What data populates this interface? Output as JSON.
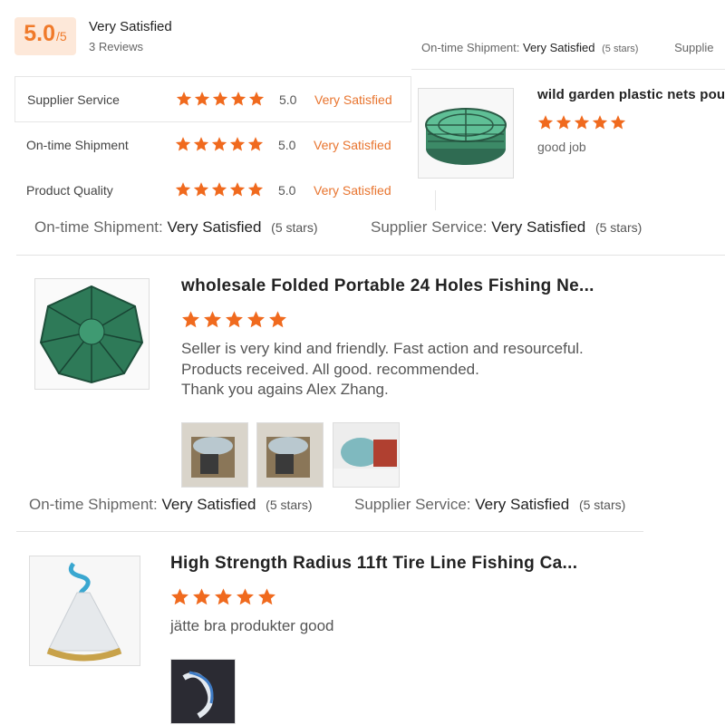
{
  "summary": {
    "score": "5.0",
    "out_of": "/5",
    "title": "Very Satisfied",
    "reviews": "3 Reviews"
  },
  "ratings": [
    {
      "label": "Supplier Service",
      "score": "5.0",
      "text": "Very Satisfied",
      "stars": 5
    },
    {
      "label": "On-time Shipment",
      "score": "5.0",
      "text": "Very Satisfied",
      "stars": 5
    },
    {
      "label": "Product Quality",
      "score": "5.0",
      "text": "Very Satisfied",
      "stars": 5
    }
  ],
  "top_review": {
    "shipment_label": "On-time Shipment:",
    "shipment_value": "Very Satisfied",
    "shipment_stars": "(5 stars)",
    "supplier_cut": "Supplie",
    "product_title": "wild garden plastic nets poult",
    "stars": 5,
    "comment": "good job"
  },
  "meta_1": {
    "shipment_label": "On-time Shipment:",
    "shipment_value": "Very Satisfied",
    "shipment_stars": "(5 stars)",
    "supplier_label": "Supplier Service:",
    "supplier_value": "Very Satisfied",
    "supplier_stars": "(5 stars)"
  },
  "review_2": {
    "product_title": "wholesale Folded Portable 24 Holes Fishing Ne...",
    "stars": 5,
    "comment_line1": "Seller is very kind and friendly. Fast action and resourceful.",
    "comment_line2": "Products received. All good. recommended.",
    "comment_line3": "Thank you agains Alex Zhang.",
    "photos": 3
  },
  "meta_2": {
    "shipment_label": "On-time Shipment:",
    "shipment_value": "Very Satisfied",
    "shipment_stars": "(5 stars)",
    "supplier_label": "Supplier Service:",
    "supplier_value": "Very Satisfied",
    "supplier_stars": "(5 stars)"
  },
  "review_3": {
    "product_title": "High Strength Radius 11ft Tire Line Fishing Ca...",
    "stars": 5,
    "comment": "jätte bra produkter good",
    "photos": 1
  },
  "colors": {
    "star": "#f06a1e",
    "accent": "#e8742e",
    "score_bg": "#fde8d9"
  }
}
